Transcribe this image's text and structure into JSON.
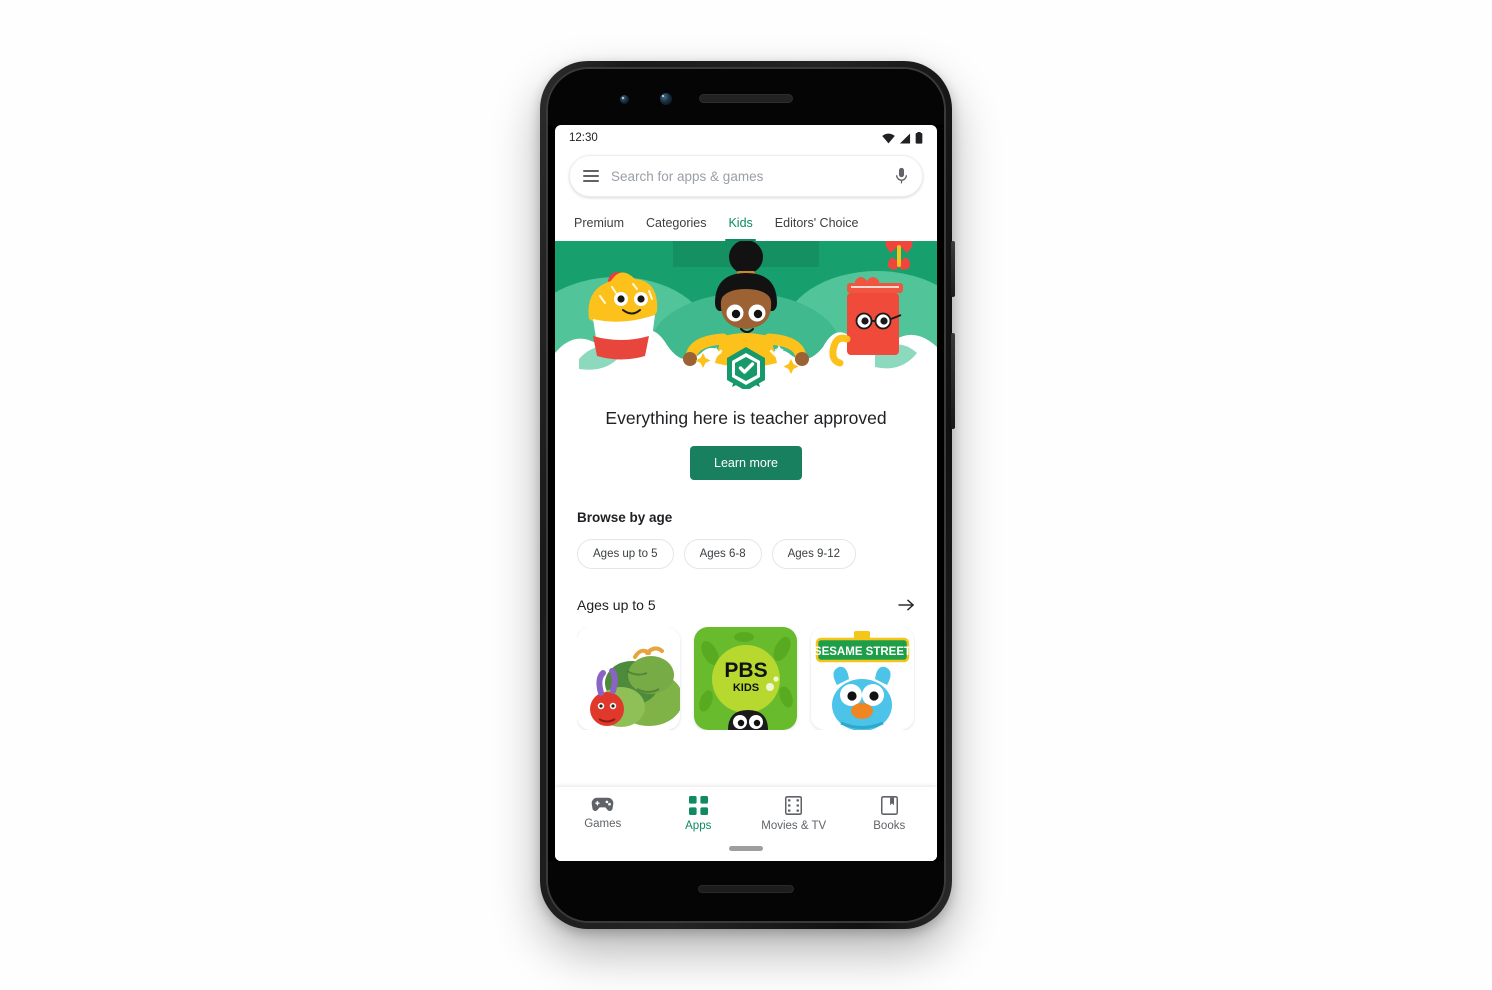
{
  "device": {
    "model": "pixel-phone"
  },
  "status_bar": {
    "time": "12:30",
    "icons": [
      "wifi-icon",
      "signal-icon",
      "battery-icon"
    ]
  },
  "search": {
    "menu_icon": "hamburger-menu-icon",
    "placeholder": "Search for apps & games",
    "voice_icon": "microphone-icon"
  },
  "tabs": [
    {
      "label": "Premium",
      "active": false
    },
    {
      "label": "Categories",
      "active": false
    },
    {
      "label": "Kids",
      "active": true
    },
    {
      "label": "Editors' Choice",
      "active": false
    }
  ],
  "hero": {
    "illustration": "kids-teacher-approved-banner",
    "characters": [
      "child-character",
      "cupcake-character",
      "book-with-glasses-character",
      "butterfly-icon",
      "verified-badge-icon"
    ],
    "title": "Everything here is teacher approved",
    "cta_label": "Learn more"
  },
  "browse_by_age": {
    "title": "Browse by age",
    "chips": [
      {
        "label": "Ages up to 5"
      },
      {
        "label": "Ages 6-8"
      },
      {
        "label": "Ages 9-12"
      }
    ]
  },
  "app_row": {
    "title": "Ages up to 5",
    "more_icon": "arrow-right-icon",
    "apps": [
      {
        "name": "Hungry Caterpillar",
        "icon": "caterpillar-app-icon"
      },
      {
        "name": "PBS KIDS",
        "icon": "pbs-kids-app-icon",
        "logo_primary": "PBS",
        "logo_secondary": "KIDS"
      },
      {
        "name": "Sesame Street",
        "icon": "sesame-street-app-icon",
        "logo_text": "SESAME STREET"
      },
      {
        "name": "",
        "icon": "partial-app-icon"
      }
    ]
  },
  "bottom_nav": [
    {
      "label": "Games",
      "icon": "gamepad-icon",
      "active": false
    },
    {
      "label": "Apps",
      "icon": "grid-apps-icon",
      "active": true
    },
    {
      "label": "Movies & TV",
      "icon": "film-strip-icon",
      "active": false
    },
    {
      "label": "Books",
      "icon": "bookmark-icon",
      "active": false
    }
  ],
  "colors": {
    "accent_green": "#0f8a62",
    "cta_green": "#19805f",
    "hero_green": "#16996b",
    "text_primary": "#202124",
    "text_secondary": "#5f6368"
  }
}
